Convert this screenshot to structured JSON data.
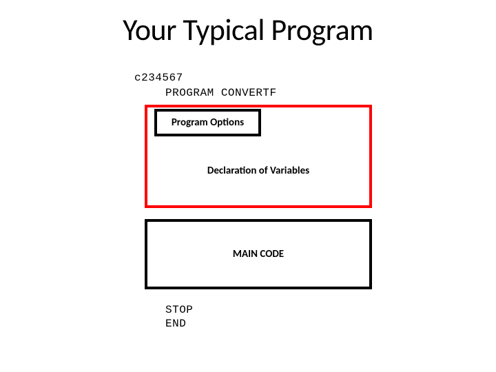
{
  "title": "Your Typical Program",
  "code": {
    "column_label": "c234567",
    "program_line": "PROGRAM CONVERTF",
    "stop": "STOP",
    "end": "END"
  },
  "boxes": {
    "options": "Program Options",
    "declaration": "Declaration of Variables",
    "main": "MAIN CODE"
  }
}
